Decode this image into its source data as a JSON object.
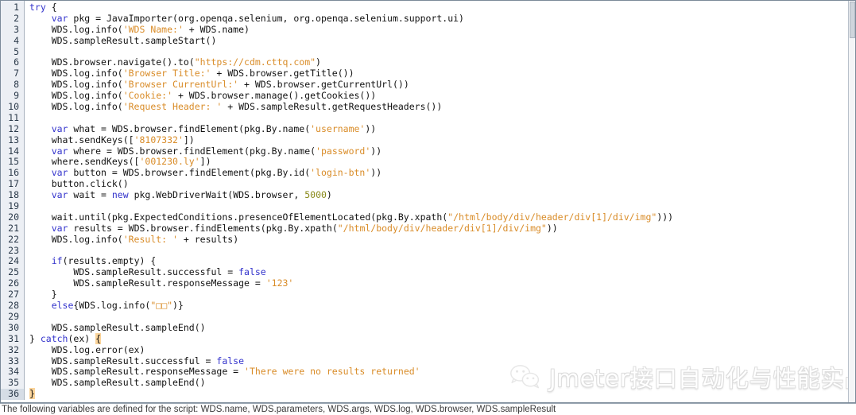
{
  "editor": {
    "language": "javascript",
    "gutter_background": "#eceff4",
    "current_line": 36,
    "colors": {
      "keyword": "#3333cc",
      "string": "#d98c28",
      "number": "#8a8a1a",
      "text": "#111111",
      "bracket_match_highlight": "#fbd49a",
      "gutter_bg": "#eceff4",
      "gutter_border": "#a9b3bf",
      "editor_bg": "#ffffff",
      "frame_border": "#7b8a99"
    },
    "line_numbers": [
      1,
      2,
      3,
      4,
      5,
      6,
      7,
      8,
      9,
      10,
      11,
      12,
      13,
      14,
      15,
      16,
      17,
      18,
      19,
      20,
      21,
      22,
      23,
      24,
      25,
      26,
      27,
      28,
      29,
      30,
      31,
      32,
      33,
      34,
      35,
      36
    ],
    "lines": [
      {
        "n": 1,
        "tokens": [
          {
            "t": "kw",
            "v": "try"
          },
          {
            "t": "plain",
            "v": " {"
          }
        ]
      },
      {
        "n": 2,
        "tokens": [
          {
            "t": "plain",
            "v": "    "
          },
          {
            "t": "kw",
            "v": "var"
          },
          {
            "t": "plain",
            "v": " pkg = JavaImporter(org.openqa.selenium, org.openqa.selenium.support.ui)"
          }
        ]
      },
      {
        "n": 3,
        "tokens": [
          {
            "t": "plain",
            "v": "    WDS.log.info("
          },
          {
            "t": "str",
            "v": "'WDS Name:'"
          },
          {
            "t": "plain",
            "v": " + WDS.name)"
          }
        ]
      },
      {
        "n": 4,
        "tokens": [
          {
            "t": "plain",
            "v": "    WDS.sampleResult.sampleStart()"
          }
        ]
      },
      {
        "n": 5,
        "tokens": [
          {
            "t": "plain",
            "v": ""
          }
        ]
      },
      {
        "n": 6,
        "tokens": [
          {
            "t": "plain",
            "v": "    WDS.browser.navigate().to("
          },
          {
            "t": "str",
            "v": "\"https://cdm.cttq.com\""
          },
          {
            "t": "plain",
            "v": ")"
          }
        ]
      },
      {
        "n": 7,
        "tokens": [
          {
            "t": "plain",
            "v": "    WDS.log.info("
          },
          {
            "t": "str",
            "v": "'Browser Title:'"
          },
          {
            "t": "plain",
            "v": " + WDS.browser.getTitle())"
          }
        ]
      },
      {
        "n": 8,
        "tokens": [
          {
            "t": "plain",
            "v": "    WDS.log.info("
          },
          {
            "t": "str",
            "v": "'Browser CurrentUrl:'"
          },
          {
            "t": "plain",
            "v": " + WDS.browser.getCurrentUrl())"
          }
        ]
      },
      {
        "n": 9,
        "tokens": [
          {
            "t": "plain",
            "v": "    WDS.log.info("
          },
          {
            "t": "str",
            "v": "'Cookie:'"
          },
          {
            "t": "plain",
            "v": " + WDS.browser.manage().getCookies())"
          }
        ]
      },
      {
        "n": 10,
        "tokens": [
          {
            "t": "plain",
            "v": "    WDS.log.info("
          },
          {
            "t": "str",
            "v": "'Request Header: '"
          },
          {
            "t": "plain",
            "v": " + WDS.sampleResult.getRequestHeaders())"
          }
        ]
      },
      {
        "n": 11,
        "tokens": [
          {
            "t": "plain",
            "v": ""
          }
        ]
      },
      {
        "n": 12,
        "tokens": [
          {
            "t": "plain",
            "v": "    "
          },
          {
            "t": "kw",
            "v": "var"
          },
          {
            "t": "plain",
            "v": " what = WDS.browser.findElement(pkg.By.name("
          },
          {
            "t": "str",
            "v": "'username'"
          },
          {
            "t": "plain",
            "v": "))"
          }
        ]
      },
      {
        "n": 13,
        "tokens": [
          {
            "t": "plain",
            "v": "    what.sendKeys(["
          },
          {
            "t": "str",
            "v": "'8107332'"
          },
          {
            "t": "plain",
            "v": "])"
          }
        ]
      },
      {
        "n": 14,
        "tokens": [
          {
            "t": "plain",
            "v": "    "
          },
          {
            "t": "kw",
            "v": "var"
          },
          {
            "t": "plain",
            "v": " where = WDS.browser.findElement(pkg.By.name("
          },
          {
            "t": "str",
            "v": "'password'"
          },
          {
            "t": "plain",
            "v": "))"
          }
        ]
      },
      {
        "n": 15,
        "tokens": [
          {
            "t": "plain",
            "v": "    where.sendKeys(["
          },
          {
            "t": "str",
            "v": "'001230.ly'"
          },
          {
            "t": "plain",
            "v": "])"
          }
        ]
      },
      {
        "n": 16,
        "tokens": [
          {
            "t": "plain",
            "v": "    "
          },
          {
            "t": "kw",
            "v": "var"
          },
          {
            "t": "plain",
            "v": " button = WDS.browser.findElement(pkg.By.id("
          },
          {
            "t": "str",
            "v": "'login-btn'"
          },
          {
            "t": "plain",
            "v": "))"
          }
        ]
      },
      {
        "n": 17,
        "tokens": [
          {
            "t": "plain",
            "v": "    button.click()"
          }
        ]
      },
      {
        "n": 18,
        "tokens": [
          {
            "t": "plain",
            "v": "    "
          },
          {
            "t": "kw",
            "v": "var"
          },
          {
            "t": "plain",
            "v": " wait = "
          },
          {
            "t": "kw",
            "v": "new"
          },
          {
            "t": "plain",
            "v": " pkg.WebDriverWait(WDS.browser, "
          },
          {
            "t": "num",
            "v": "5000"
          },
          {
            "t": "plain",
            "v": ")"
          }
        ]
      },
      {
        "n": 19,
        "tokens": [
          {
            "t": "plain",
            "v": ""
          }
        ]
      },
      {
        "n": 20,
        "tokens": [
          {
            "t": "plain",
            "v": "    wait.until(pkg.ExpectedConditions.presenceOfElementLocated(pkg.By.xpath("
          },
          {
            "t": "str",
            "v": "\"/html/body/div/header/div[1]/div/img\""
          },
          {
            "t": "plain",
            "v": ")))"
          }
        ]
      },
      {
        "n": 21,
        "tokens": [
          {
            "t": "plain",
            "v": "    "
          },
          {
            "t": "kw",
            "v": "var"
          },
          {
            "t": "plain",
            "v": " results = WDS.browser.findElements(pkg.By.xpath("
          },
          {
            "t": "str",
            "v": "\"/html/body/div/header/div[1]/div/img\""
          },
          {
            "t": "plain",
            "v": "))"
          }
        ]
      },
      {
        "n": 22,
        "tokens": [
          {
            "t": "plain",
            "v": "    WDS.log.info("
          },
          {
            "t": "str",
            "v": "'Result: '"
          },
          {
            "t": "plain",
            "v": " + results)"
          }
        ]
      },
      {
        "n": 23,
        "tokens": [
          {
            "t": "plain",
            "v": ""
          }
        ]
      },
      {
        "n": 24,
        "tokens": [
          {
            "t": "plain",
            "v": "    "
          },
          {
            "t": "kw",
            "v": "if"
          },
          {
            "t": "plain",
            "v": "(results.empty) {"
          }
        ]
      },
      {
        "n": 25,
        "tokens": [
          {
            "t": "plain",
            "v": "        WDS.sampleResult.successful = "
          },
          {
            "t": "kw",
            "v": "false"
          }
        ]
      },
      {
        "n": 26,
        "tokens": [
          {
            "t": "plain",
            "v": "        WDS.sampleResult.responseMessage = "
          },
          {
            "t": "str",
            "v": "'123'"
          }
        ]
      },
      {
        "n": 27,
        "tokens": [
          {
            "t": "plain",
            "v": "    }"
          }
        ]
      },
      {
        "n": 28,
        "tokens": [
          {
            "t": "plain",
            "v": "    "
          },
          {
            "t": "kw",
            "v": "else"
          },
          {
            "t": "plain",
            "v": "{WDS.log.info("
          },
          {
            "t": "str",
            "v": "\"□□\""
          },
          {
            "t": "plain",
            "v": ")}"
          }
        ]
      },
      {
        "n": 29,
        "tokens": [
          {
            "t": "plain",
            "v": ""
          }
        ]
      },
      {
        "n": 30,
        "tokens": [
          {
            "t": "plain",
            "v": "    WDS.sampleResult.sampleEnd()"
          }
        ]
      },
      {
        "n": 31,
        "tokens": [
          {
            "t": "plain",
            "v": "} "
          },
          {
            "t": "kw",
            "v": "catch"
          },
          {
            "t": "plain",
            "v": "(ex) "
          },
          {
            "t": "brk",
            "v": "{"
          }
        ]
      },
      {
        "n": 32,
        "tokens": [
          {
            "t": "plain",
            "v": "    WDS.log.error(ex)"
          }
        ]
      },
      {
        "n": 33,
        "tokens": [
          {
            "t": "plain",
            "v": "    WDS.sampleResult.successful = "
          },
          {
            "t": "kw",
            "v": "false"
          }
        ]
      },
      {
        "n": 34,
        "tokens": [
          {
            "t": "plain",
            "v": "    WDS.sampleResult.responseMessage = "
          },
          {
            "t": "str",
            "v": "'There were no results returned'"
          }
        ]
      },
      {
        "n": 35,
        "tokens": [
          {
            "t": "plain",
            "v": "    WDS.sampleResult.sampleEnd()"
          }
        ]
      },
      {
        "n": 36,
        "tokens": [
          {
            "t": "brk",
            "v": "}"
          }
        ]
      }
    ]
  },
  "watermark": {
    "icon": "wechat-icon",
    "text": "Jmeter接口自动化与性能实战"
  },
  "statusbar": {
    "text": "The following variables are defined for the script: WDS.name, WDS.parameters, WDS.args, WDS.log, WDS.browser, WDS.sampleResult"
  },
  "scrollbar": {
    "orientation": "vertical",
    "thumb_position": "top"
  }
}
